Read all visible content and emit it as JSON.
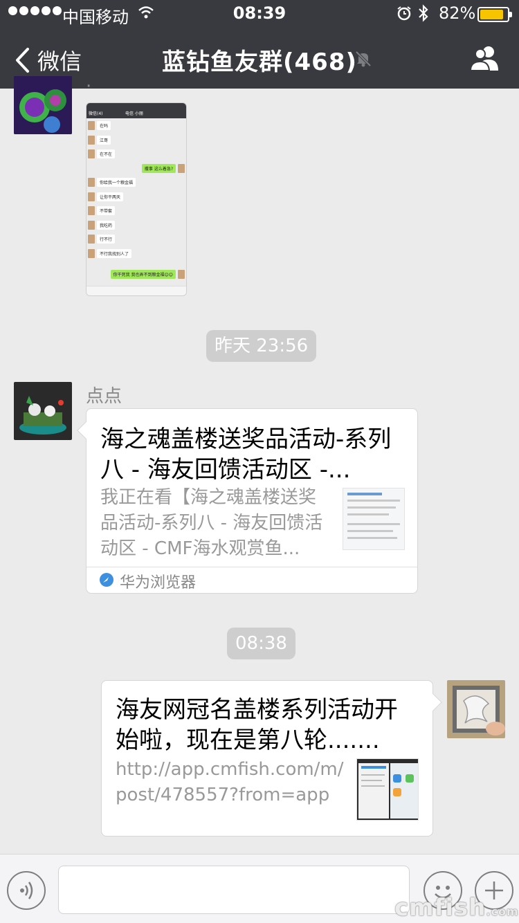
{
  "status_bar": {
    "carrier": "中国移动",
    "time": "08:39",
    "battery_pct": "82%",
    "battery_level": 0.82
  },
  "nav": {
    "back_label": "微信",
    "title": "蓝钻鱼友群(468)"
  },
  "chat": {
    "top_fragment": "·",
    "screenshot_thumb": {
      "header_left": "微信(4)",
      "header_center": "电信 小丽",
      "messages": [
        {
          "side": "left",
          "text": "在吗"
        },
        {
          "side": "left",
          "text": "江哥"
        },
        {
          "side": "left",
          "text": "在不在"
        },
        {
          "side": "right",
          "text": "撒事 这么着急?"
        },
        {
          "side": "left",
          "text": "你给我一个粮金福"
        },
        {
          "side": "left",
          "text": "让你干两天"
        },
        {
          "side": "left",
          "text": "不带套"
        },
        {
          "side": "left",
          "text": "我吃药"
        },
        {
          "side": "left",
          "text": "行不行"
        },
        {
          "side": "left",
          "text": "不行我找别人了"
        },
        {
          "side": "right",
          "text": "你干死我 我也弄不到粮金福😊😊"
        }
      ]
    },
    "timestamp_1": "昨天 23:56",
    "msg_1": {
      "sender": "点点",
      "title": "海之魂盖楼送奖品活动-系列八 - 海友回馈活动区 -...",
      "description": "我正在看【海之魂盖楼送奖品活动-系列八 - 海友回馈活动区 - CMF海水观赏鱼...",
      "source": "华为浏览器"
    },
    "timestamp_2": "08:38",
    "msg_2": {
      "title": "海友网冠名盖楼系列活动开始啦，现在是第八轮.......",
      "description": "http://app.cmfish.com/m/post/478557?from=app"
    }
  },
  "watermark": "cmfish",
  "watermark_suffix": ".com"
}
